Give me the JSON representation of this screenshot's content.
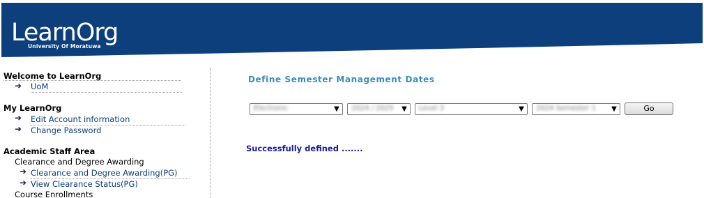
{
  "header": {
    "logo_title": "LearnOrg",
    "logo_subtitle": "University Of Moratuwa",
    "colors": {
      "banner": "#0d3f7c",
      "curve": "#ffffff"
    }
  },
  "sidebar": {
    "sections": [
      {
        "title": "Welcome to LearnOrg",
        "links": [
          "UoM"
        ]
      },
      {
        "title": "My LearnOrg",
        "links": [
          "Edit Account information",
          "Change Password"
        ]
      },
      {
        "title": "Academic Staff Area",
        "groups": [
          {
            "heading": "Clearance and Degree Awarding",
            "links": [
              "Clearance and Degree Awarding(PG)",
              "View Clearance Status(PG)"
            ]
          },
          {
            "heading": "Course Enrollments"
          }
        ]
      }
    ]
  },
  "main": {
    "title": "Define Semester Management Dates",
    "selects": [
      {
        "value": "Electronic"
      },
      {
        "value": "2024 / 2025"
      },
      {
        "value": "Level 3"
      },
      {
        "value": "2024 Semester 1"
      }
    ],
    "go_label": "Go",
    "status_message": "Successfully defined .......",
    "colors": {
      "title": "#3a8cc0",
      "status": "#1a1aa0",
      "link": "#0d3f7c"
    }
  }
}
